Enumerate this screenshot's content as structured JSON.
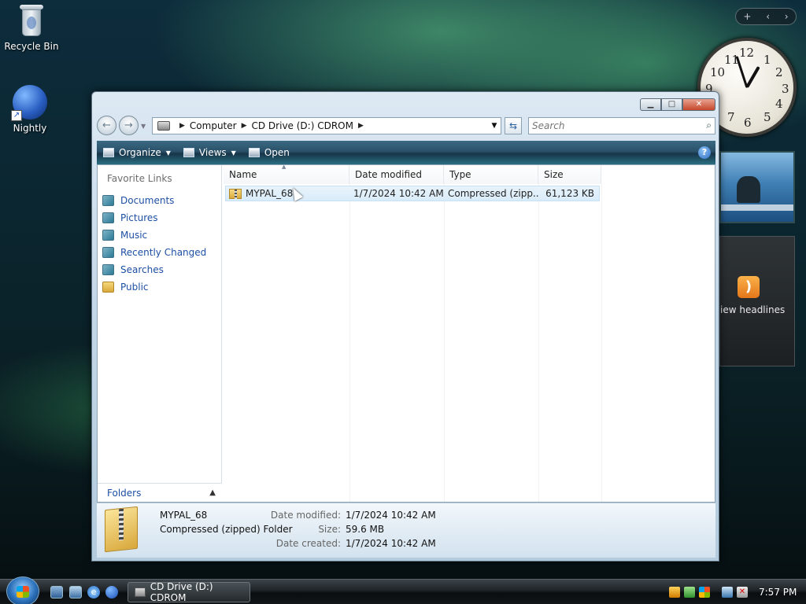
{
  "desktop": {
    "icons": [
      {
        "label": "Recycle Bin",
        "icon": "recycle-bin-icon"
      },
      {
        "label": "Nightly",
        "icon": "globe-shortcut-icon"
      }
    ]
  },
  "gadgets": {
    "controls": [
      "+",
      "‹",
      "›"
    ],
    "clock_numbers": [
      "12",
      "1",
      "2",
      "3",
      "4",
      "5",
      "6",
      "7",
      "8",
      "9",
      "10",
      "11"
    ],
    "feed_text": "iew headlines",
    "feed_icon": "rss-icon"
  },
  "window": {
    "address": {
      "segments": [
        "Computer",
        "CD Drive (D:) CDROM"
      ],
      "search_placeholder": "Search"
    },
    "commands": {
      "organize": "Organize",
      "views": "Views",
      "open": "Open",
      "help": "?"
    },
    "nav": {
      "title": "Favorite Links",
      "items": [
        "Documents",
        "Pictures",
        "Music",
        "Recently Changed",
        "Searches",
        "Public"
      ],
      "folders_label": "Folders"
    },
    "columns": {
      "name": "Name",
      "date": "Date modified",
      "type": "Type",
      "size": "Size"
    },
    "files": [
      {
        "name": "MYPAL_68",
        "date": "1/7/2024 10:42 AM",
        "type": "Compressed (zipp...",
        "size": "61,123 KB"
      }
    ],
    "details": {
      "name": "MYPAL_68",
      "type": "Compressed (zipped) Folder",
      "date_modified_label": "Date modified:",
      "date_modified": "1/7/2024 10:42 AM",
      "size_label": "Size:",
      "size": "59.6 MB",
      "date_created_label": "Date created:",
      "date_created": "1/7/2024 10:42 AM"
    }
  },
  "taskbar": {
    "task_label": "CD Drive (D:) CDROM",
    "time": "7:57 PM"
  },
  "colors": {
    "link": "#1e4fa4",
    "command_bar": "#2a5069"
  }
}
